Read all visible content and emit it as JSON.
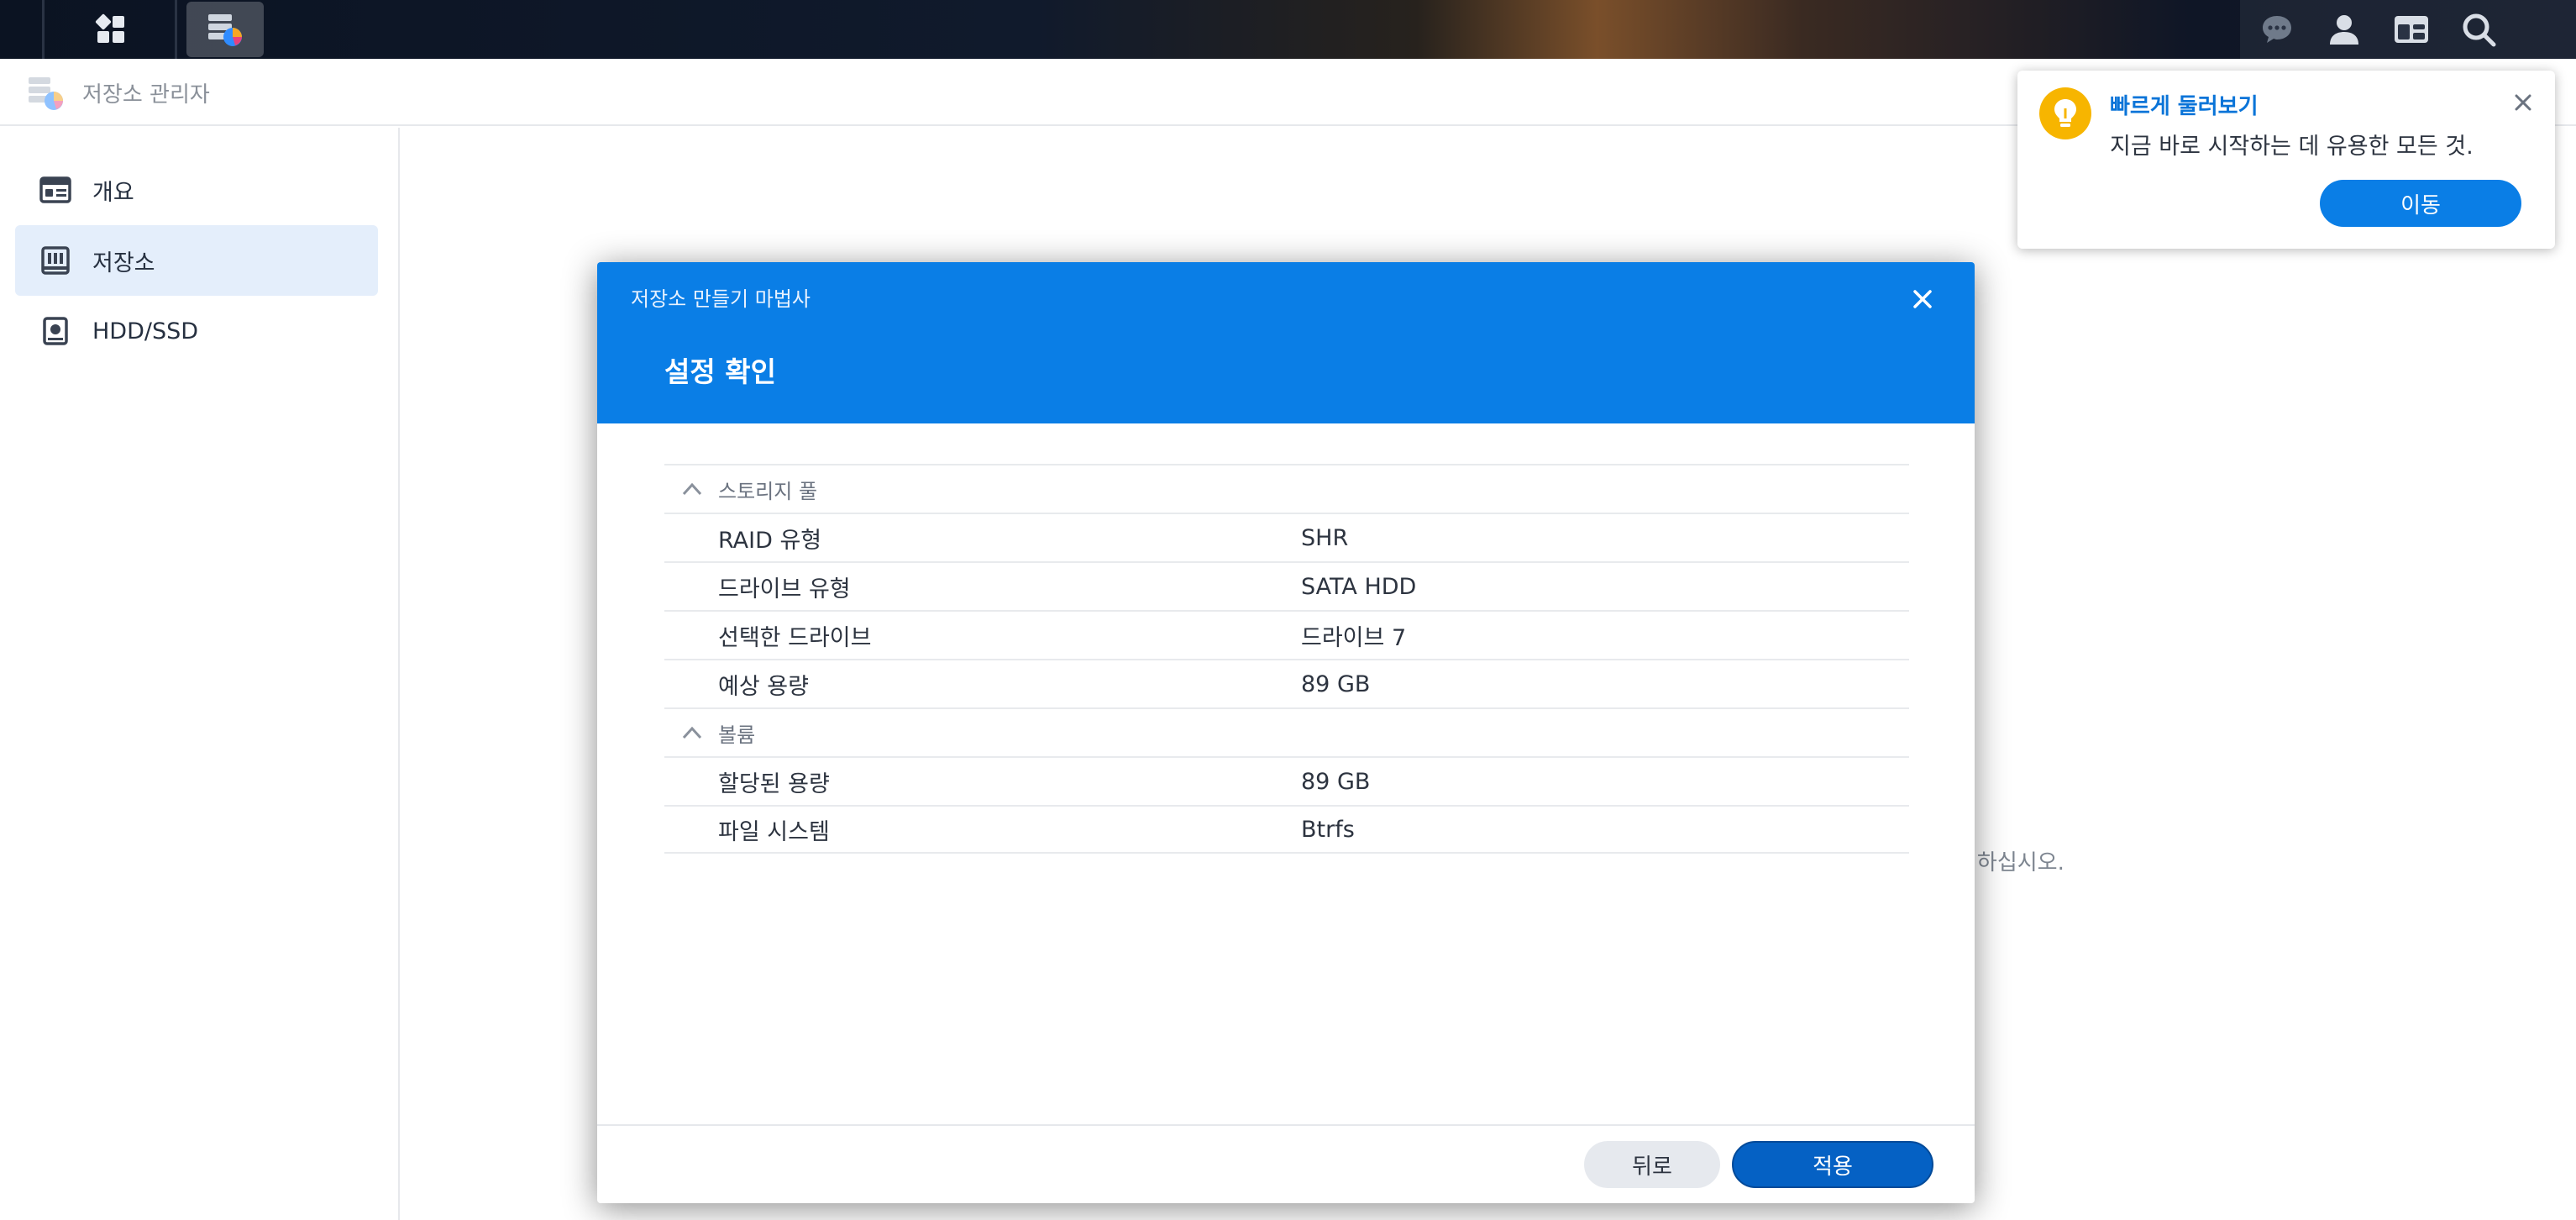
{
  "app": {
    "title": "저장소 관리자"
  },
  "sidebar": {
    "items": [
      {
        "label": "개요",
        "icon": "overview-card-icon",
        "active": false
      },
      {
        "label": "저장소",
        "icon": "storage-columns-icon",
        "active": true
      },
      {
        "label": "HDD/SSD",
        "icon": "disk-icon",
        "active": false
      }
    ]
  },
  "background": {
    "hint_text": "성하십시오."
  },
  "modal": {
    "wizard_title": "저장소 만들기 마법사",
    "step_title": "설정 확인",
    "groups": [
      {
        "label": "스토리지 풀",
        "rows": [
          {
            "key": "RAID 유형",
            "value": "SHR"
          },
          {
            "key": "드라이브 유형",
            "value": "SATA HDD"
          },
          {
            "key": "선택한 드라이브",
            "value": "드라이브 7"
          },
          {
            "key": "예상 용량",
            "value": "89 GB"
          }
        ]
      },
      {
        "label": "볼륨",
        "rows": [
          {
            "key": "할당된 용량",
            "value": "89 GB"
          },
          {
            "key": "파일 시스템",
            "value": "Btrfs"
          }
        ]
      }
    ],
    "back_label": "뒤로",
    "apply_label": "적용"
  },
  "toast": {
    "title": "빠르게 둘러보기",
    "body": "지금 바로 시작하는 데 유용한 모든 것.",
    "button_label": "이동"
  },
  "colors": {
    "accent": "#0a7ee6",
    "apply_button": "#0561c4",
    "sidebar_active": "#e4eefb",
    "toast_bulb": "#f7b500"
  }
}
